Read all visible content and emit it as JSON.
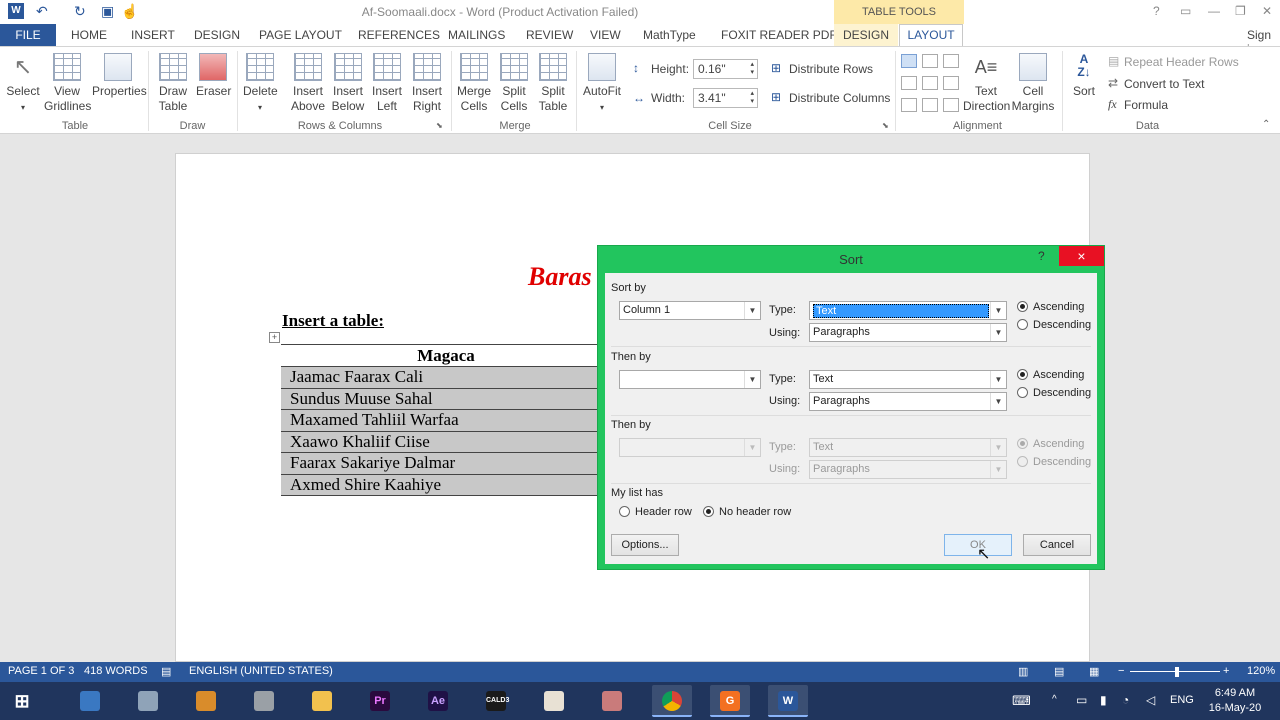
{
  "window": {
    "title": "Af-Soomaali.docx - Word (Product Activation Failed)",
    "contextual_group": "TABLE TOOLS",
    "sign_in": "Sign in"
  },
  "tabs": [
    "FILE",
    "HOME",
    "INSERT",
    "DESIGN",
    "PAGE LAYOUT",
    "REFERENCES",
    "MAILINGS",
    "REVIEW",
    "VIEW",
    "MathType",
    "FOXIT READER PDF",
    "DESIGN",
    "LAYOUT"
  ],
  "ribbon": {
    "table": {
      "select": "Select",
      "view_gridlines_1": "View",
      "view_gridlines_2": "Gridlines",
      "properties": "Properties",
      "group": "Table"
    },
    "draw": {
      "draw_table_1": "Draw",
      "draw_table_2": "Table",
      "eraser": "Eraser",
      "group": "Draw"
    },
    "rows_cols": {
      "delete": "Delete",
      "above_1": "Insert",
      "above_2": "Above",
      "below_1": "Insert",
      "below_2": "Below",
      "left_1": "Insert",
      "left_2": "Left",
      "right_1": "Insert",
      "right_2": "Right",
      "group": "Rows & Columns"
    },
    "merge": {
      "merge_1": "Merge",
      "merge_2": "Cells",
      "split_1": "Split",
      "split_2": "Cells",
      "splitt_1": "Split",
      "splitt_2": "Table",
      "group": "Merge"
    },
    "cell_size": {
      "autofit": "AutoFit",
      "height_label": "Height:",
      "height_value": "0.16\"",
      "width_label": "Width:",
      "width_value": "3.41\"",
      "distribute_rows": "Distribute Rows",
      "distribute_columns": "Distribute Columns",
      "group": "Cell Size"
    },
    "alignment": {
      "text_dir_1": "Text",
      "text_dir_2": "Direction",
      "margins_1": "Cell",
      "margins_2": "Margins",
      "group": "Alignment"
    },
    "data": {
      "sort": "Sort",
      "repeat_header": "Repeat Header Rows",
      "convert": "Convert to Text",
      "formula": "Formula",
      "group": "Data"
    }
  },
  "document": {
    "title_fragment": "Baras",
    "insert_label": "Insert a table:",
    "table_header": "Magaca",
    "rows": [
      "Jaamac Faarax Cali",
      "Sundus Muuse Sahal",
      "Maxamed Tahliil Warfaa",
      "Xaawo Khaliif Ciise",
      "Faarax Sakariye Dalmar",
      "Axmed Shire Kaahiye"
    ]
  },
  "dialog": {
    "title": "Sort",
    "help": "?",
    "close": "×",
    "sort_by_label": "Sort by",
    "sort_by_value": "Column 1",
    "type_label": "Type:",
    "using_label": "Using:",
    "type1_value": "Text",
    "using1_value": "Paragraphs",
    "then_by_label": "Then by",
    "then_by1_value": "",
    "type2_value": "Text",
    "using2_value": "Paragraphs",
    "then_by2_value": "",
    "type3_value": "Text",
    "using3_value": "Paragraphs",
    "ascending": "Ascending",
    "descending": "Descending",
    "list_has_label": "My list has",
    "header_row": "Header row",
    "no_header_row": "No header row",
    "options_button": "Options...",
    "ok_button": "OK",
    "cancel_button": "Cancel"
  },
  "statusbar": {
    "page": "PAGE 1 OF 3",
    "words": "418 WORDS",
    "language": "ENGLISH (UNITED STATES)",
    "zoom": "120%"
  },
  "taskbar": {
    "lang": "ENG",
    "time": "6:49 AM",
    "date": "16-May-20"
  }
}
